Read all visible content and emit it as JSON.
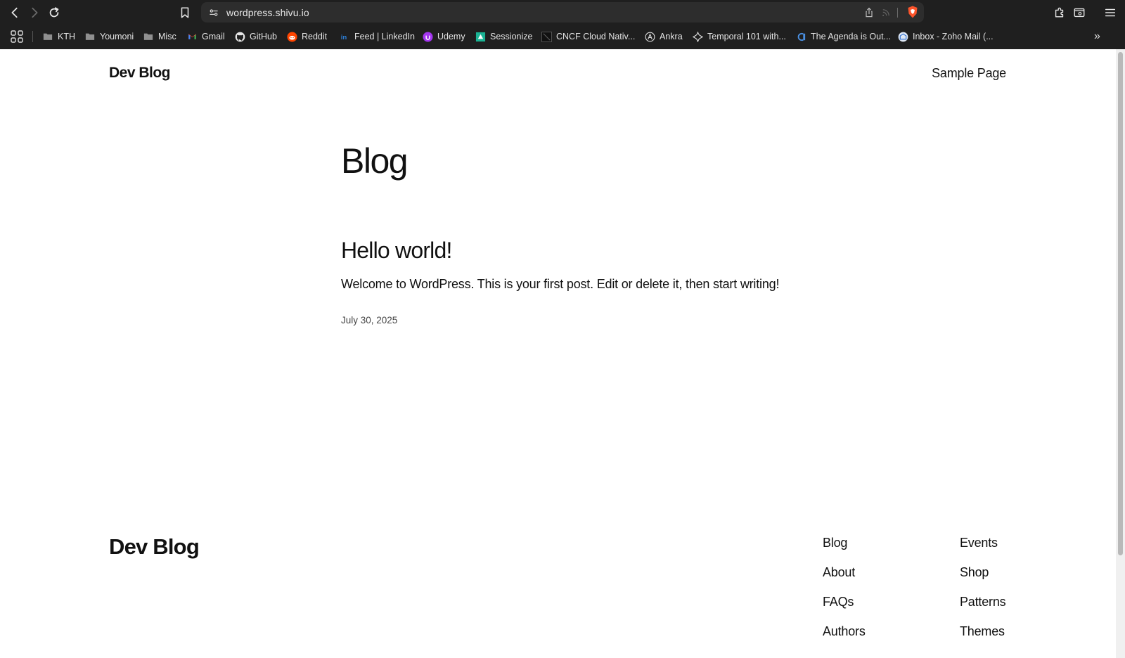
{
  "browser": {
    "url": "wordpress.shivu.io",
    "bookmarks": [
      {
        "label": "KTH",
        "icon": "folder-icon"
      },
      {
        "label": "Youmoni",
        "icon": "folder-icon"
      },
      {
        "label": "Misc",
        "icon": "folder-icon"
      },
      {
        "label": "Gmail",
        "icon": "gmail-icon"
      },
      {
        "label": "GitHub",
        "icon": "github-icon"
      },
      {
        "label": "Reddit",
        "icon": "reddit-icon"
      },
      {
        "label": "Feed | LinkedIn",
        "icon": "linkedin-icon"
      },
      {
        "label": "Udemy",
        "icon": "udemy-icon"
      },
      {
        "label": "Sessionize",
        "icon": "sessionize-icon"
      },
      {
        "label": "CNCF Cloud Nativ...",
        "icon": "cncf-icon"
      },
      {
        "label": "Ankra",
        "icon": "ankra-icon"
      },
      {
        "label": "Temporal 101 with...",
        "icon": "temporal-icon"
      },
      {
        "label": "The Agenda is Out...",
        "icon": "agenda-icon"
      },
      {
        "label": "Inbox - Zoho Mail (...",
        "icon": "zoho-icon"
      }
    ],
    "more": "»"
  },
  "site": {
    "title": "Dev Blog",
    "nav": [
      "Sample Page"
    ]
  },
  "main": {
    "heading": "Blog",
    "posts": [
      {
        "title": "Hello world!",
        "excerpt": "Welcome to WordPress. This is your first post. Edit or delete it, then start writing!",
        "date": "July 30, 2025"
      }
    ]
  },
  "footer": {
    "title": "Dev Blog",
    "columns": [
      [
        "Blog",
        "About",
        "FAQs",
        "Authors"
      ],
      [
        "Events",
        "Shop",
        "Patterns",
        "Themes"
      ]
    ]
  },
  "colors": {
    "chrome_bg": "#1f1f1f",
    "urlbar_bg": "#2d2d2d",
    "page_bg": "#ffffff",
    "text": "#111111",
    "brave_orange": "#fb542b"
  }
}
